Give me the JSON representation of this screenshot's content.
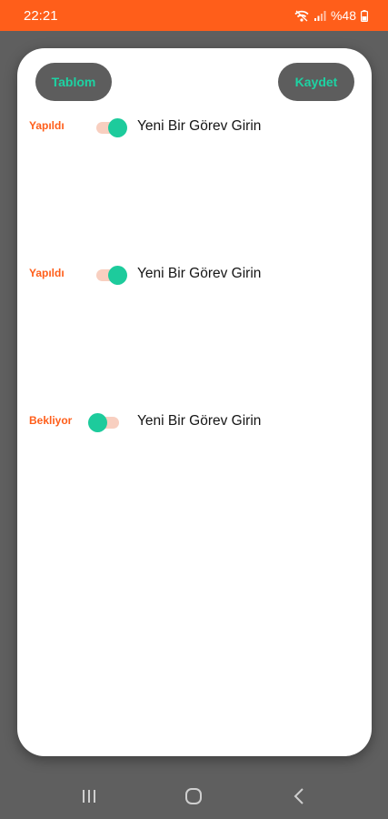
{
  "status_bar": {
    "time": "22:21",
    "battery_text": "%48",
    "icons": [
      "wifi-icon",
      "signal-icon",
      "battery-icon"
    ]
  },
  "header": {
    "table_button_label": "Tablom",
    "save_button_label": "Kaydet"
  },
  "tasks": [
    {
      "status": "Yapıldı",
      "done": true,
      "text": "Yeni Bir Görev Girin"
    },
    {
      "status": "Yapıldı",
      "done": true,
      "text": "Yeni Bir Görev Girin"
    },
    {
      "status": "Bekliyor",
      "done": false,
      "text": "Yeni Bir Görev Girin"
    }
  ],
  "nav_bar": {
    "icons": [
      "recent-apps-icon",
      "home-icon",
      "back-icon"
    ]
  },
  "colors": {
    "accent_orange": "#ff5e1a",
    "accent_green": "#1dcb9c",
    "background": "#5f5f5f",
    "button_bg": "#5d5d5d",
    "switch_track": "#f8cfc0"
  }
}
